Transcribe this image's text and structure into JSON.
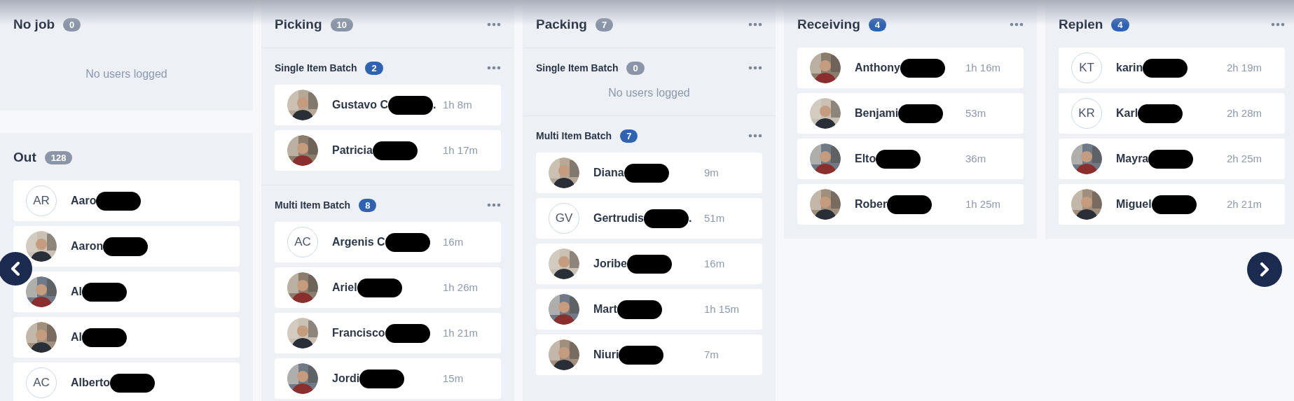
{
  "columns": [
    {
      "panels": [
        {
          "title": "No job",
          "badge": {
            "text": "0",
            "color": "#8a95a8"
          },
          "menu": false,
          "empty_text": "No users logged"
        },
        {
          "title": "Out",
          "badge": {
            "text": "128",
            "color": "#8a95a8"
          },
          "menu": false,
          "users": [
            {
              "name": "Aaro",
              "redacted": true,
              "avatar": {
                "kind": "initials",
                "text": "AR"
              }
            },
            {
              "name": "Aaron",
              "redacted": true
            },
            {
              "name": "Al",
              "redacted": true
            },
            {
              "name": "Al",
              "redacted": true
            },
            {
              "name": "Alberto",
              "redacted": true,
              "avatar": {
                "kind": "initials",
                "text": "AC"
              }
            }
          ]
        }
      ]
    },
    {
      "panels": [
        {
          "title": "Picking",
          "badge": {
            "text": "10",
            "color": "#8a95a8"
          },
          "menu": true,
          "sections": [
            {
              "title": "Single Item Batch",
              "badge": {
                "text": "2",
                "color": "#2f62b3"
              },
              "menu": true,
              "users": [
                {
                  "name": "Gustavo C",
                  "tail": ".",
                  "redacted": true,
                  "time": "1h 8m"
                },
                {
                  "name": "Patricia",
                  "redacted": true,
                  "time": "1h 17m"
                }
              ]
            },
            {
              "title": "Multi Item Batch",
              "badge": {
                "text": "8",
                "color": "#2f62b3"
              },
              "menu": true,
              "users": [
                {
                  "name": "Argenis C",
                  "redacted": true,
                  "avatar": {
                    "kind": "initials",
                    "text": "AC"
                  },
                  "time": "16m"
                },
                {
                  "name": "Ariel",
                  "redacted": true,
                  "time": "1h 26m"
                },
                {
                  "name": "Francisco",
                  "redacted": true,
                  "time": "1h 21m"
                },
                {
                  "name": "Jordi",
                  "redacted": true,
                  "time": "15m"
                }
              ]
            }
          ]
        }
      ]
    },
    {
      "panels": [
        {
          "title": "Packing",
          "badge": {
            "text": "7",
            "color": "#8a95a8"
          },
          "menu": true,
          "sections": [
            {
              "title": "Single Item Batch",
              "badge": {
                "text": "0",
                "color": "#8a95a8"
              },
              "menu": true,
              "empty_text": "No users logged"
            },
            {
              "title": "Multi Item Batch",
              "badge": {
                "text": "7",
                "color": "#2f62b3"
              },
              "menu": true,
              "users": [
                {
                  "name": "Diana",
                  "redacted": true,
                  "time": "9m"
                },
                {
                  "name": "Gertrudis",
                  "tail": ".",
                  "redacted": true,
                  "avatar": {
                    "kind": "initials",
                    "text": "GV"
                  },
                  "time": "51m"
                },
                {
                  "name": "Joribe",
                  "redacted": true,
                  "time": "16m"
                },
                {
                  "name": "Mart",
                  "redacted": true,
                  "time": "1h 15m"
                },
                {
                  "name": "Niuri",
                  "redacted": true,
                  "time": "7m"
                }
              ]
            }
          ]
        }
      ]
    },
    {
      "panels": [
        {
          "title": "Receiving",
          "badge": {
            "text": "4",
            "color": "#2f62b3"
          },
          "menu": true,
          "users": [
            {
              "name": "Anthony",
              "redacted": true,
              "time": "1h 16m"
            },
            {
              "name": "Benjami",
              "redacted": true,
              "time": "53m"
            },
            {
              "name": "Elto",
              "redacted": true,
              "time": "36m"
            },
            {
              "name": "Rober",
              "redacted": true,
              "time": "1h 25m"
            }
          ]
        }
      ]
    },
    {
      "panels": [
        {
          "title": "Replen",
          "badge": {
            "text": "4",
            "color": "#2f62b3"
          },
          "menu": true,
          "users": [
            {
              "name": "karin",
              "redacted": true,
              "avatar": {
                "kind": "initials",
                "text": "KT"
              },
              "time": "2h 19m"
            },
            {
              "name": "Karl",
              "redacted": true,
              "avatar": {
                "kind": "initials",
                "text": "KR"
              },
              "time": "2h 28m"
            },
            {
              "name": "Mayra",
              "redacted": true,
              "time": "2h 25m"
            },
            {
              "name": "Miguel",
              "redacted": true,
              "time": "2h 21m"
            }
          ]
        }
      ]
    }
  ],
  "nav": {
    "previous": true,
    "next": true
  }
}
